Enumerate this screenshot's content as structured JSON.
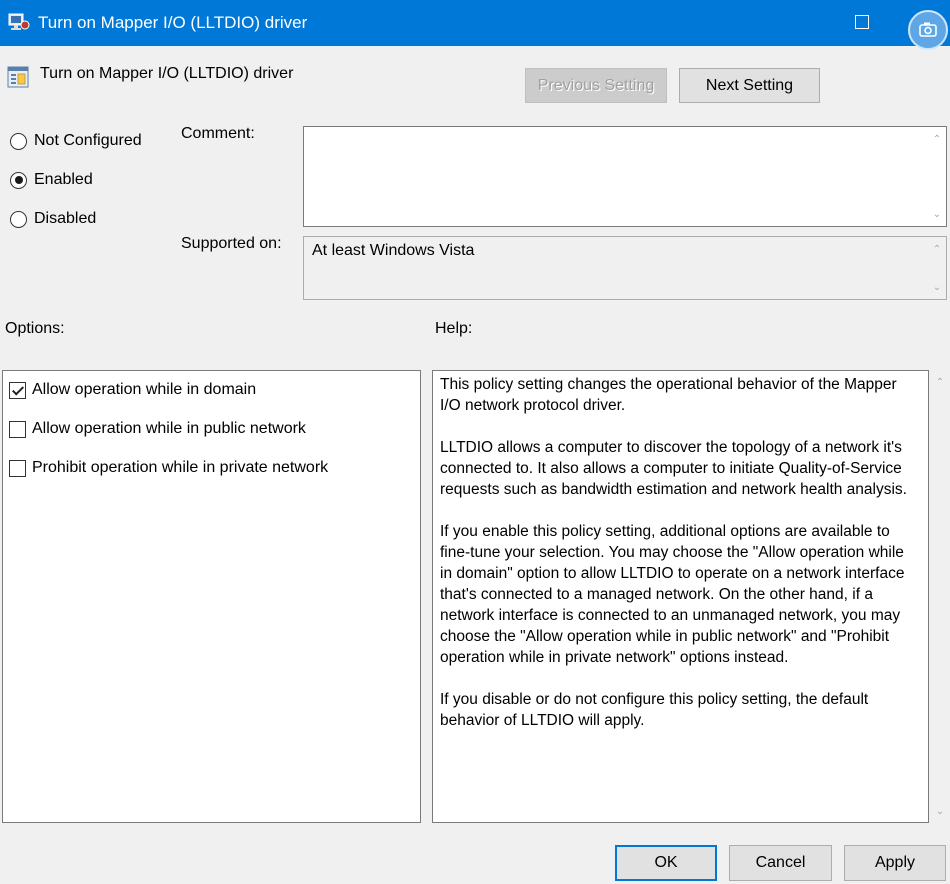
{
  "window": {
    "title": "Turn on Mapper I/O (LLTDIO) driver"
  },
  "policy": {
    "name": "Turn on Mapper I/O (LLTDIO) driver"
  },
  "nav": {
    "previous_label": "Previous Setting",
    "next_label": "Next Setting"
  },
  "state": {
    "options": [
      {
        "label": "Not Configured",
        "checked": false
      },
      {
        "label": "Enabled",
        "checked": true
      },
      {
        "label": "Disabled",
        "checked": false
      }
    ]
  },
  "comment": {
    "label": "Comment:",
    "value": ""
  },
  "supported": {
    "label": "Supported on:",
    "value": "At least Windows Vista"
  },
  "options_section": {
    "label": "Options:",
    "items": [
      {
        "label": "Allow operation while in domain",
        "checked": true
      },
      {
        "label": "Allow operation while in public network",
        "checked": false
      },
      {
        "label": "Prohibit operation while in private network",
        "checked": false
      }
    ]
  },
  "help_section": {
    "label": "Help:",
    "paragraphs": [
      "This policy setting changes the operational behavior of the Mapper I/O network protocol driver.",
      "LLTDIO allows a computer to discover the topology of a network it's connected to. It also allows a computer to initiate Quality-of-Service requests such as bandwidth estimation and network health analysis.",
      "If you enable this policy setting, additional options are available to fine-tune your selection. You may choose the \"Allow operation while in domain\" option to allow LLTDIO to operate on a network interface that's connected to a managed network. On the other hand, if a network interface is connected to an unmanaged network, you may choose the \"Allow operation while in public network\" and \"Prohibit operation while in private network\" options instead.",
      "If you disable or do not configure this policy setting, the default behavior of LLTDIO will apply."
    ]
  },
  "footer": {
    "ok_label": "OK",
    "cancel_label": "Cancel",
    "apply_label": "Apply"
  },
  "colors": {
    "titlebar": "#0078d7",
    "window_bg": "#f0f0f0"
  }
}
